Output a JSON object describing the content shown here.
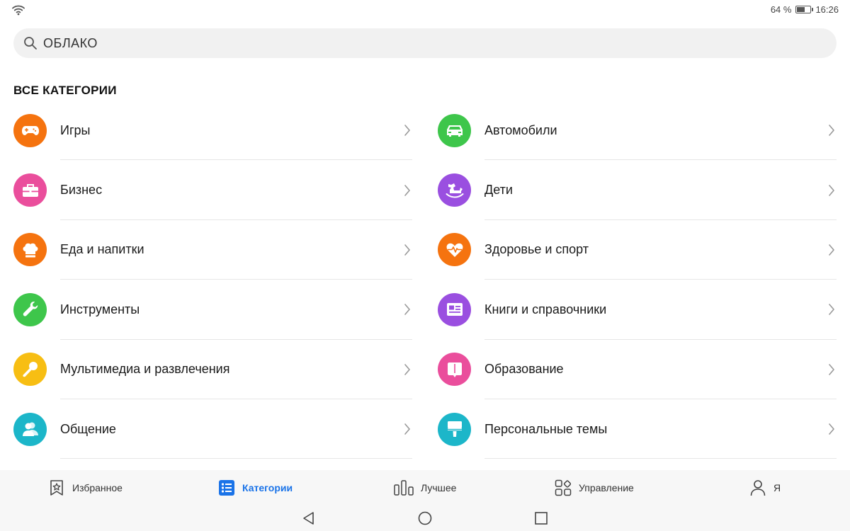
{
  "status": {
    "battery": "64 %",
    "battery_level": 0.64,
    "time": "16:26"
  },
  "search": {
    "value": "ОБЛАКО"
  },
  "section": {
    "title": "ВСЕ КАТЕГОРИИ"
  },
  "categories_left": [
    {
      "label": "Игры",
      "icon": "gamepad-icon",
      "color": "#f5730f"
    },
    {
      "label": "Бизнес",
      "icon": "briefcase-icon",
      "color": "#ea4e9c"
    },
    {
      "label": "Еда и напитки",
      "icon": "chef-hat-icon",
      "color": "#f5730f"
    },
    {
      "label": "Инструменты",
      "icon": "wrench-icon",
      "color": "#3ec64b"
    },
    {
      "label": "Мультимедиа и развлечения",
      "icon": "microphone-icon",
      "color": "#f7be13"
    },
    {
      "label": "Общение",
      "icon": "contacts-icon",
      "color": "#1cb6c9"
    }
  ],
  "categories_right": [
    {
      "label": "Автомобили",
      "icon": "car-icon",
      "color": "#3ec64b"
    },
    {
      "label": "Дети",
      "icon": "rocking-horse-icon",
      "color": "#9a4fe0"
    },
    {
      "label": "Здоровье и спорт",
      "icon": "heart-pulse-icon",
      "color": "#f5730f"
    },
    {
      "label": "Книги и справочники",
      "icon": "book-reference-icon",
      "color": "#9a4fe0"
    },
    {
      "label": "Образование",
      "icon": "open-book-icon",
      "color": "#ea4e9c"
    },
    {
      "label": "Персональные темы",
      "icon": "paint-brush-icon",
      "color": "#1cb6c9"
    }
  ],
  "bottom_nav": [
    {
      "label": "Избранное",
      "icon": "star-bookmark-icon"
    },
    {
      "label": "Категории",
      "icon": "category-list-icon",
      "active": true
    },
    {
      "label": "Лучшее",
      "icon": "bar-chart-icon"
    },
    {
      "label": "Управление",
      "icon": "apps-grid-icon"
    },
    {
      "label": "Я",
      "icon": "person-icon"
    }
  ],
  "colors": {
    "accent": "#1a73e8"
  }
}
